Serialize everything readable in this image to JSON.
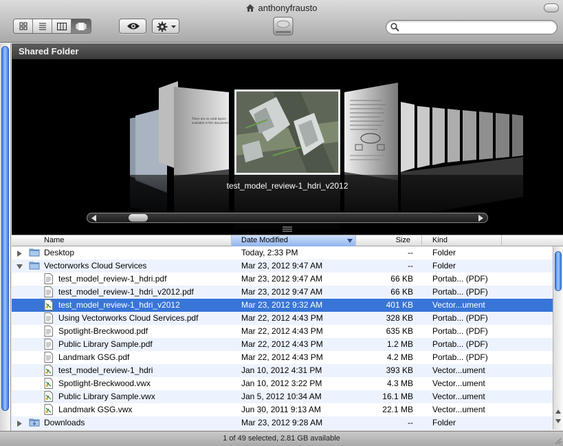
{
  "window": {
    "title": "anthonyfrausto"
  },
  "toolbar": {
    "view_modes": [
      "icon-view",
      "list-view",
      "column-view",
      "cover-flow-view"
    ],
    "active_view": 3
  },
  "search": {
    "placeholder": "",
    "value": ""
  },
  "pathbar": {
    "title": "Shared Folder"
  },
  "coverflow": {
    "current_label": "test_model_review-1_hdri_v2012",
    "scroll_fraction": 0.07
  },
  "columns": {
    "name": "Name",
    "date": "Date Modified",
    "size": "Size",
    "kind": "Kind"
  },
  "rows": [
    {
      "name": "Desktop",
      "date": "Today, 2:33 PM",
      "size": "--",
      "kind": "Folder",
      "icon": "folder-icon",
      "indent": 0,
      "expand": "collapsed"
    },
    {
      "name": "Vectorworks Cloud Services",
      "date": "Mar 23, 2012 9:47 AM",
      "size": "--",
      "kind": "Folder",
      "icon": "folder-icon",
      "indent": 0,
      "expand": "expanded"
    },
    {
      "name": "test_model_review-1_hdri.pdf",
      "date": "Mar 23, 2012 9:47 AM",
      "size": "66 KB",
      "kind": "Portab... (PDF)",
      "icon": "pdf-doc-icon",
      "indent": 1,
      "expand": "none"
    },
    {
      "name": "test_model_review-1_hdri_v2012.pdf",
      "date": "Mar 23, 2012 9:47 AM",
      "size": "66 KB",
      "kind": "Portab... (PDF)",
      "icon": "pdf-doc-icon",
      "indent": 1,
      "expand": "none"
    },
    {
      "name": "test_model_review-1_hdri_v2012",
      "date": "Mar 23, 2012 9:32 AM",
      "size": "401 KB",
      "kind": "Vector...ument",
      "icon": "vectorworks-doc-icon",
      "indent": 1,
      "expand": "none",
      "selected": true
    },
    {
      "name": "Using Vectorworks Cloud Services.pdf",
      "date": "Mar 22, 2012 4:43 PM",
      "size": "328 KB",
      "kind": "Portab... (PDF)",
      "icon": "pdf-doc-icon",
      "indent": 1,
      "expand": "none"
    },
    {
      "name": "Spotlight-Breckwood.pdf",
      "date": "Mar 22, 2012 4:43 PM",
      "size": "635 KB",
      "kind": "Portab... (PDF)",
      "icon": "pdf-doc-icon",
      "indent": 1,
      "expand": "none"
    },
    {
      "name": "Public Library Sample.pdf",
      "date": "Mar 22, 2012 4:43 PM",
      "size": "1.2 MB",
      "kind": "Portab... (PDF)",
      "icon": "pdf-doc-icon",
      "indent": 1,
      "expand": "none"
    },
    {
      "name": "Landmark GSG.pdf",
      "date": "Mar 22, 2012 4:43 PM",
      "size": "4.2 MB",
      "kind": "Portab... (PDF)",
      "icon": "pdf-doc-icon",
      "indent": 1,
      "expand": "none"
    },
    {
      "name": "test_model_review-1_hdri",
      "date": "Jan 10, 2012 4:31 PM",
      "size": "393 KB",
      "kind": "Vector...ument",
      "icon": "vectorworks-doc-icon",
      "indent": 1,
      "expand": "none"
    },
    {
      "name": "Spotlight-Breckwood.vwx",
      "date": "Jan 10, 2012 3:22 PM",
      "size": "4.3 MB",
      "kind": "Vector...ument",
      "icon": "vectorworks-doc-icon",
      "indent": 1,
      "expand": "none"
    },
    {
      "name": "Public Library Sample.vwx",
      "date": "Jan 5, 2012 10:34 AM",
      "size": "16.1 MB",
      "kind": "Vector...ument",
      "icon": "vectorworks-doc-icon",
      "indent": 1,
      "expand": "none"
    },
    {
      "name": "Landmark GSG.vwx",
      "date": "Jun 30, 2011 9:13 AM",
      "size": "22.1 MB",
      "kind": "Vector...ument",
      "icon": "vectorworks-doc-icon",
      "indent": 1,
      "expand": "none"
    },
    {
      "name": "Downloads",
      "date": "Mar 23, 2012 9:28 AM",
      "size": "--",
      "kind": "Folder",
      "icon": "downloads-folder-icon",
      "indent": 0,
      "expand": "collapsed"
    }
  ],
  "status": {
    "text": "1 of 49 selected, 2.81 GB available"
  },
  "colors": {
    "selection": "#3875d7",
    "alt_row": "#edf3fe",
    "accent": "#3b7be0"
  }
}
